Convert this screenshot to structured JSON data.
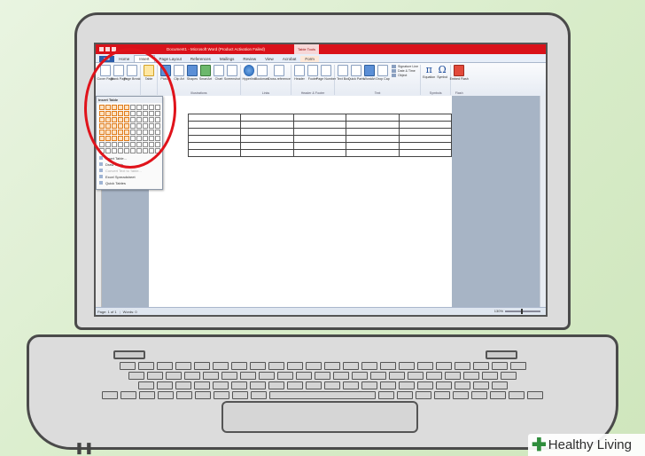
{
  "window": {
    "title": "Document1 - Microsoft Word (Product Activation Failed)",
    "context_tab": "Table Tools"
  },
  "tabs": [
    {
      "label": "File"
    },
    {
      "label": "Home"
    },
    {
      "label": "Insert"
    },
    {
      "label": "Page Layout"
    },
    {
      "label": "References"
    },
    {
      "label": "Mailings"
    },
    {
      "label": "Review"
    },
    {
      "label": "View"
    },
    {
      "label": "Acrobat"
    },
    {
      "label": "Form"
    }
  ],
  "ribbon": {
    "pages": {
      "cover": "Cover Page",
      "blank": "Blank Page",
      "break": "Page Break"
    },
    "tables": {
      "table": "Table"
    },
    "illustrations": {
      "picture": "Picture",
      "clipart": "Clip Art",
      "shapes": "Shapes",
      "smartart": "SmartArt",
      "chart": "Chart",
      "screenshot": "Screenshot",
      "group": "Illustrations"
    },
    "links": {
      "hyperlink": "Hyperlink",
      "bookmark": "Bookmark",
      "crossref": "Cross-reference",
      "group": "Links"
    },
    "header_footer": {
      "header": "Header",
      "footer": "Footer",
      "page_number": "Page Number",
      "group": "Header & Footer"
    },
    "text": {
      "textbox": "Text Box",
      "quickparts": "Quick Parts",
      "wordart": "WordArt",
      "dropcap": "Drop Cap",
      "signature": "Signature Line",
      "datetime": "Date & Time",
      "object": "Object",
      "group": "Text"
    },
    "symbols": {
      "equation": "Equation",
      "symbol": "Symbol",
      "group": "Symbols",
      "equation_glyph": "π",
      "symbol_glyph": "Ω"
    },
    "flash": {
      "embed": "Embed Flash",
      "group": "Flash"
    }
  },
  "dropdown": {
    "header": "Insert Table",
    "grid": {
      "cols": 10,
      "rows": 8,
      "sel_cols": 5,
      "sel_rows": 6
    },
    "items": [
      {
        "label": "Insert Table...",
        "disabled": false
      },
      {
        "label": "Draw Table",
        "disabled": false
      },
      {
        "label": "Convert Text to Table...",
        "disabled": true
      },
      {
        "label": "Excel Spreadsheet",
        "disabled": false
      },
      {
        "label": "Quick Tables",
        "disabled": false
      }
    ]
  },
  "document_table": {
    "rows": 6,
    "cols": 5
  },
  "status": {
    "page": "Page: 1 of 1",
    "words": "Words: 0",
    "zoom": "130%"
  },
  "brand": {
    "text": "Healthy Living",
    "cross": "✚"
  }
}
